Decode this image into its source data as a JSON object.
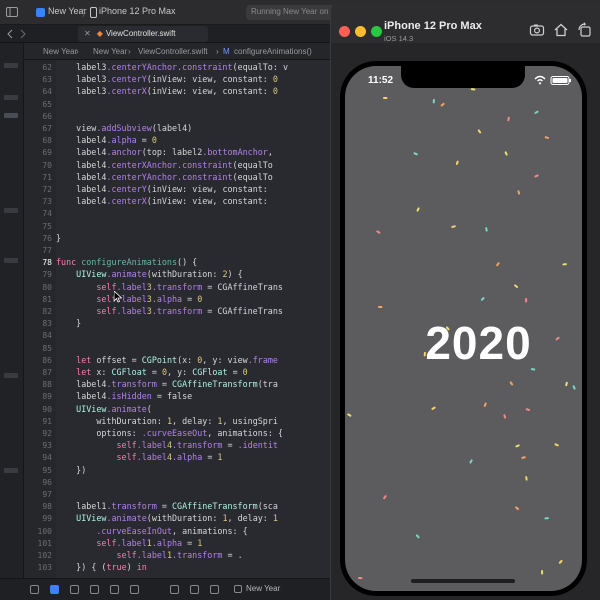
{
  "toolbar": {
    "scheme": "New Year",
    "device": "iPhone 12 Pro Max",
    "status": "Running New Year on iPhone 12 Pro Max"
  },
  "tab": {
    "file": "ViewController.swift"
  },
  "jumpbar": {
    "project": "New Year",
    "group": "New Year",
    "file": "ViewController.swift",
    "symbol": "configureAnimations()"
  },
  "editor": {
    "current_line": "78",
    "lines": [
      {
        "n": "62",
        "t": "    label3.centerYAnchor.constraint(equalTo: v"
      },
      {
        "n": "63",
        "t": "    label3.centerY(inView: view, constant: 0"
      },
      {
        "n": "64",
        "t": "    label3.centerX(inView: view, constant: 0"
      },
      {
        "n": "65",
        "t": ""
      },
      {
        "n": "66",
        "t": ""
      },
      {
        "n": "67",
        "t": "    view.addSubview(label4)"
      },
      {
        "n": "68",
        "t": "    label4.alpha = 0"
      },
      {
        "n": "69",
        "t": "    label4.anchor(top: label2.bottomAnchor,"
      },
      {
        "n": "70",
        "t": "    label4.centerXAnchor.constraint(equalTo"
      },
      {
        "n": "71",
        "t": "    label4.centerYAnchor.constraint(equalTo"
      },
      {
        "n": "72",
        "t": "    label4.centerY(inView: view, constant:"
      },
      {
        "n": "73",
        "t": "    label4.centerX(inView: view, constant:"
      },
      {
        "n": "74",
        "t": ""
      },
      {
        "n": "75",
        "t": ""
      },
      {
        "n": "76",
        "t": "}"
      },
      {
        "n": "77",
        "t": ""
      },
      {
        "n": "78",
        "t": "func configureAnimations() {"
      },
      {
        "n": "79",
        "t": "    UIView.animate(withDuration: 2) {"
      },
      {
        "n": "80",
        "t": "        self.label3.transform = CGAffineTrans"
      },
      {
        "n": "81",
        "t": "        self.label3.alpha = 0"
      },
      {
        "n": "82",
        "t": "        self.label3.transform = CGAffineTrans"
      },
      {
        "n": "83",
        "t": "    }"
      },
      {
        "n": "84",
        "t": ""
      },
      {
        "n": "85",
        "t": ""
      },
      {
        "n": "86",
        "t": "    let offset = CGPoint(x: 0, y: view.frame"
      },
      {
        "n": "87",
        "t": "    let x: CGFloat = 0, y: CGFloat = 0"
      },
      {
        "n": "88",
        "t": "    label4.transform = CGAffineTransform(tra"
      },
      {
        "n": "89",
        "t": "    label4.isHidden = false"
      },
      {
        "n": "90",
        "t": "    UIView.animate("
      },
      {
        "n": "91",
        "t": "        withDuration: 1, delay: 1, usingSpri"
      },
      {
        "n": "92",
        "t": "        options: .curveEaseOut, animations: {"
      },
      {
        "n": "93",
        "t": "            self.label4.transform = .identit"
      },
      {
        "n": "94",
        "t": "            self.label4.alpha = 1"
      },
      {
        "n": "95",
        "t": "    })"
      },
      {
        "n": "96",
        "t": ""
      },
      {
        "n": "97",
        "t": ""
      },
      {
        "n": "98",
        "t": "    label1.transform = CGAffineTransform(sca"
      },
      {
        "n": "99",
        "t": "    UIView.animate(withDuration: 1, delay: 1"
      },
      {
        "n": "100",
        "t": "        .curveEaseInOut, animations: {"
      },
      {
        "n": "101",
        "t": "        self.label1.alpha = 1"
      },
      {
        "n": "102",
        "t": "            self.label1.transform = ."
      },
      {
        "n": "103",
        "t": "    }) { (true) in"
      }
    ]
  },
  "debug": {
    "target": "New Year"
  },
  "simulator": {
    "device_name": "iPhone 12 Pro Max",
    "os_version": "iOS 14.3",
    "status_time": "11:52",
    "headline": "2020"
  },
  "colors": {
    "screen_bg": "#5c5c5e",
    "editor_bg": "#292a30",
    "confetti": [
      "#f6d36b",
      "#f08a8a",
      "#7ad6c4",
      "#f5a35c",
      "#e8e070"
    ]
  },
  "icons": {
    "traffic_lights": [
      "close-light",
      "minimize-light",
      "zoom-light"
    ],
    "sim_buttons": [
      "screenshot-icon",
      "home-icon",
      "rotate-icon"
    ]
  }
}
